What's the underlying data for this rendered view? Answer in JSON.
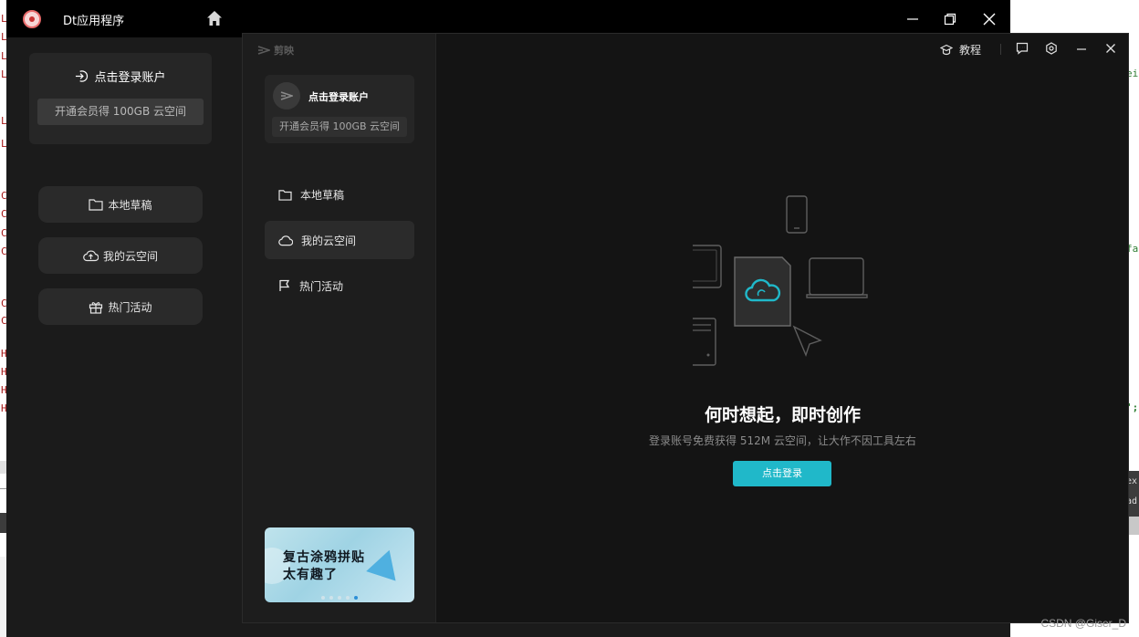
{
  "background": {
    "left_gutter_chars": [
      "L",
      "L",
      "L",
      "L",
      "L",
      "L",
      "C",
      "C",
      "C",
      "C",
      "C",
      "C",
      "H",
      "H",
      "H",
      "H"
    ],
    "right_snippets": [
      "ei",
      "fa",
      "';",
      "ex",
      "ad"
    ],
    "watermark": "CSDN @Giser_D"
  },
  "dt_app": {
    "title": "Dt应用程序",
    "login": {
      "label": "点击登录账户",
      "vip_banner": "开通会员得 100GB 云空间"
    },
    "nav": [
      {
        "label": "本地草稿",
        "icon": "folder-icon"
      },
      {
        "label": "我的云空间",
        "icon": "cloud-upload-icon"
      },
      {
        "label": "热门活动",
        "icon": "gift-icon"
      }
    ]
  },
  "capcut": {
    "brand": "剪映",
    "login": {
      "label": "点击登录账户",
      "vip_banner": "开通会员得 100GB 云空间"
    },
    "nav": [
      {
        "label": "本地草稿",
        "icon": "folder-icon",
        "active": false
      },
      {
        "label": "我的云空间",
        "icon": "cloud-icon",
        "active": true
      },
      {
        "label": "热门活动",
        "icon": "flag-icon",
        "active": false
      }
    ],
    "toolbar": {
      "tutorial": "教程"
    },
    "banner": {
      "line1": "复古涂鸦拼贴",
      "line2": "太有趣了"
    },
    "empty_state": {
      "headline": "何时想起，即时创作",
      "subtext": "登录账号免费获得 512M 云空间，让大作不因工具左右",
      "button": "点击登录"
    },
    "colors": {
      "accent": "#20b8c9"
    }
  }
}
